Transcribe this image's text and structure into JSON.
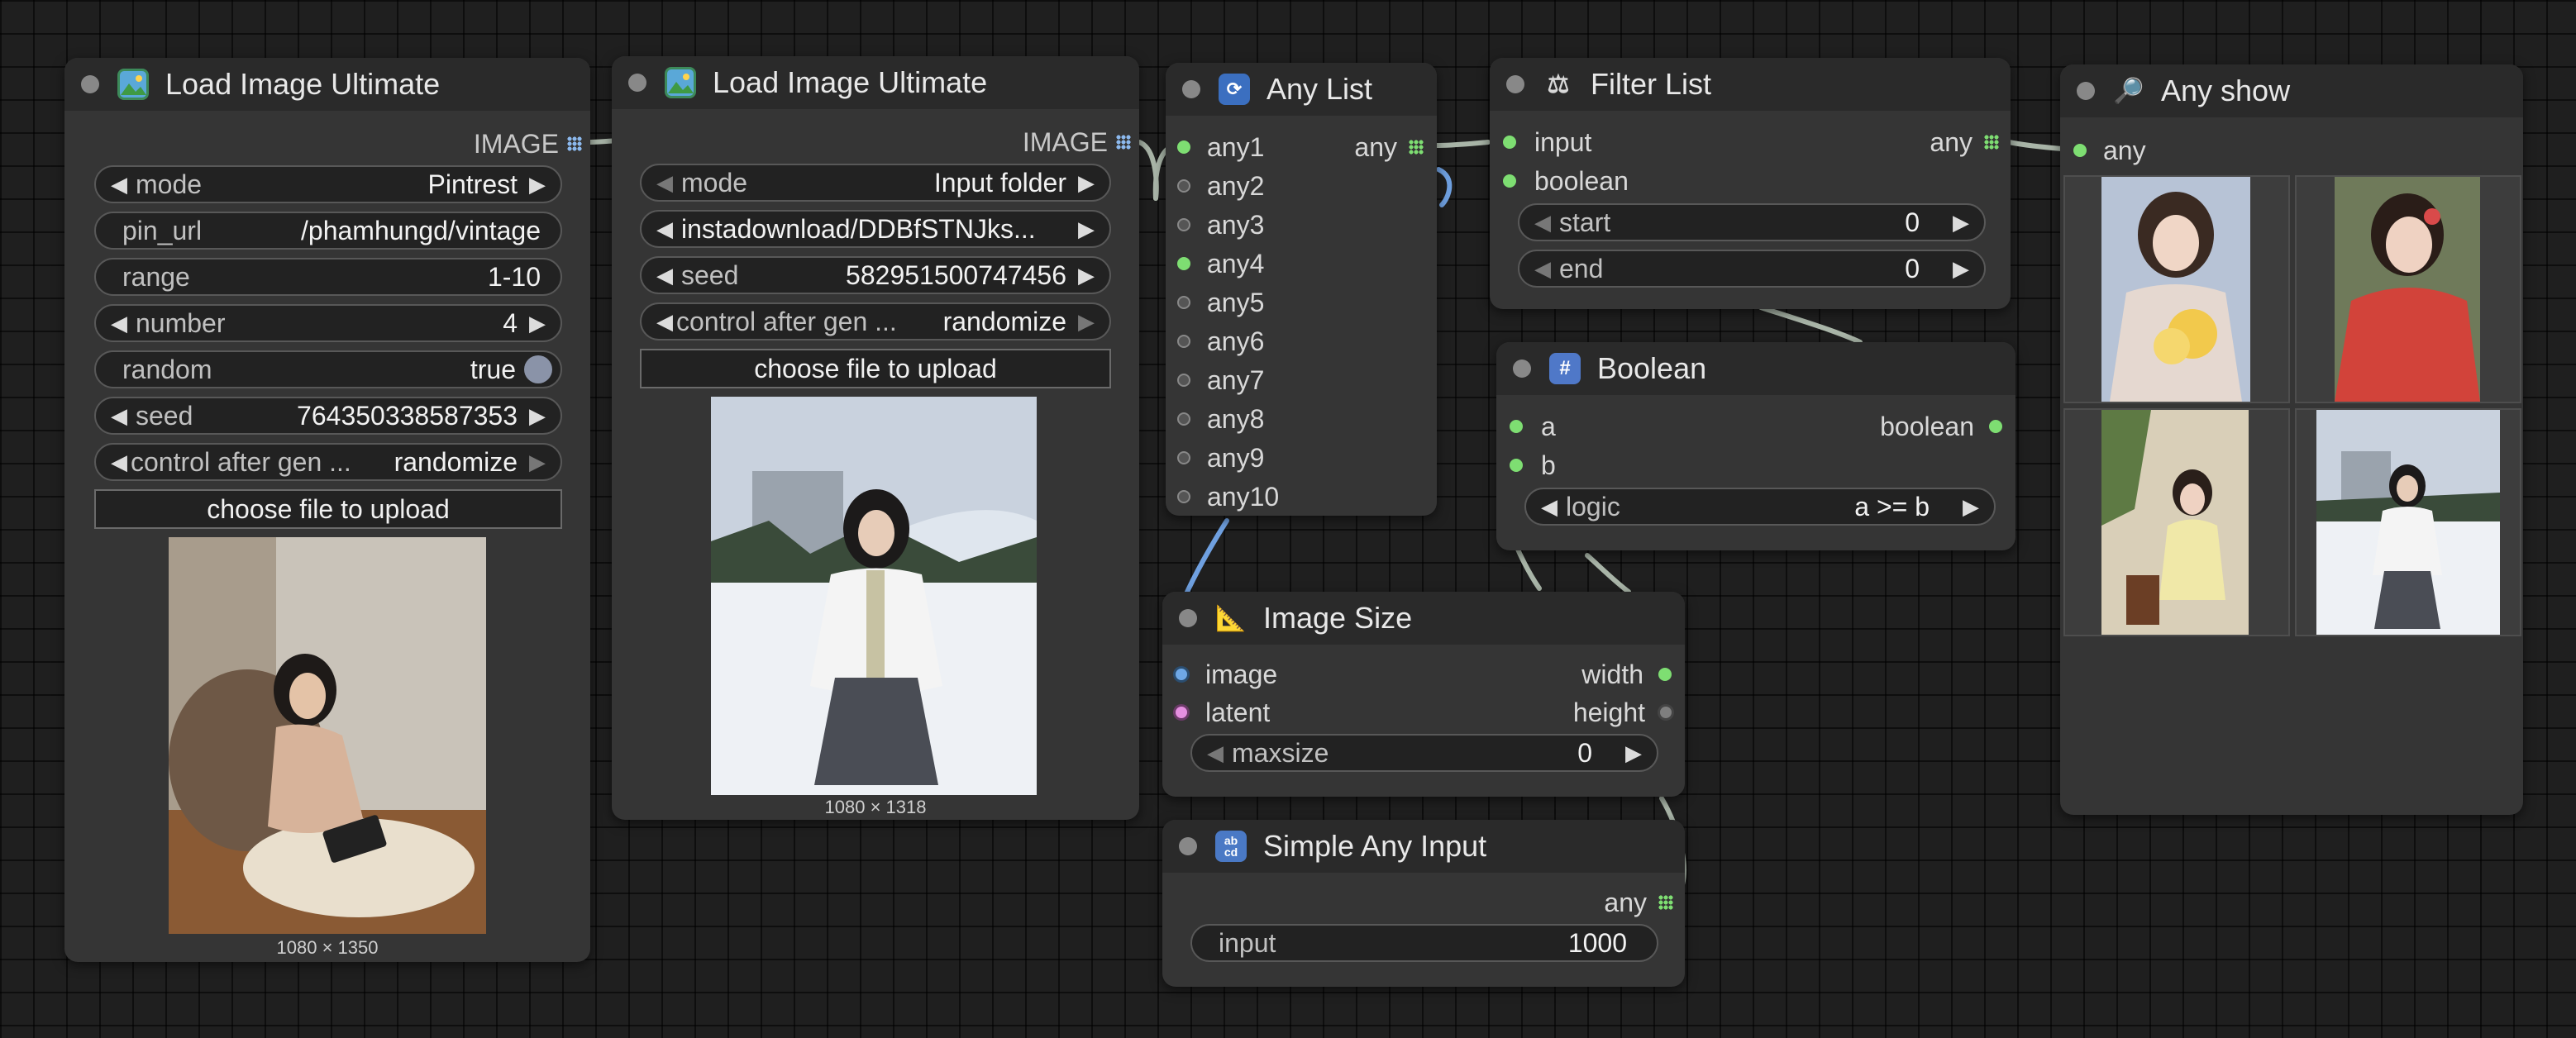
{
  "nodes": {
    "load1": {
      "title": "Load Image Ultimate",
      "output_label": "IMAGE",
      "widgets": {
        "mode": {
          "name": "mode",
          "value": "Pintrest"
        },
        "pin_url": {
          "name": "pin_url",
          "value": "/phamhungd/vintage"
        },
        "range": {
          "name": "range",
          "value": "1-10"
        },
        "number": {
          "name": "number",
          "value": "4"
        },
        "random": {
          "name": "random",
          "value": "true"
        },
        "seed": {
          "name": "seed",
          "value": "764350338587353"
        },
        "control": {
          "name": "control after gen ...",
          "value": "randomize"
        }
      },
      "upload_label": "choose file to upload",
      "preview_size": "1080 × 1350"
    },
    "load2": {
      "title": "Load Image Ultimate",
      "output_label": "IMAGE",
      "widgets": {
        "mode": {
          "name": "mode",
          "value": "Input folder"
        },
        "file": {
          "value": "instadownload/DDBfSTNJks..."
        },
        "seed": {
          "name": "seed",
          "value": "582951500747456"
        },
        "control": {
          "name": "control after gen ...",
          "value": "randomize"
        }
      },
      "upload_label": "choose file to upload",
      "preview_size": "1080 × 1318"
    },
    "any_list": {
      "title": "Any List",
      "output_label": "any",
      "inputs": [
        "any1",
        "any2",
        "any3",
        "any4",
        "any5",
        "any6",
        "any7",
        "any8",
        "any9",
        "any10"
      ]
    },
    "filter_list": {
      "title": "Filter List",
      "inputs": [
        "input",
        "boolean"
      ],
      "output_label": "any",
      "widgets": {
        "start": {
          "name": "start",
          "value": "0"
        },
        "end": {
          "name": "end",
          "value": "0"
        }
      }
    },
    "boolean": {
      "title": "Boolean",
      "inputs": [
        "a",
        "b"
      ],
      "output_label": "boolean",
      "widgets": {
        "logic": {
          "name": "logic",
          "value": "a >= b"
        }
      }
    },
    "image_size": {
      "title": "Image Size",
      "inputs": [
        "image",
        "latent"
      ],
      "outputs": [
        "width",
        "height"
      ],
      "widgets": {
        "maxsize": {
          "name": "maxsize",
          "value": "0"
        }
      }
    },
    "simple_any": {
      "title": "Simple Any Input",
      "output_label": "any",
      "widgets": {
        "input": {
          "name": "input",
          "value": "1000"
        }
      }
    },
    "any_show": {
      "title": "Any show",
      "input_label": "any",
      "thumbnails": 4
    }
  },
  "icons": {
    "load_image": "image-icon",
    "any_list": "refresh-icon",
    "filter_list": "scales-icon",
    "boolean": "hash-icon",
    "image_size": "ruler-triangle-icon",
    "simple_any": "abcd-icon",
    "any_show": "magnifier-icon"
  },
  "colors": {
    "canvas": "#1f1f1f",
    "node_body": "#353535",
    "node_header": "#2a2a2a",
    "pin_green": "#7ede72",
    "pin_image": "#6fa8e6",
    "pin_latent": "#e58fe0",
    "wire": "#a9b5a8",
    "wire_image": "#6fa0e0"
  }
}
